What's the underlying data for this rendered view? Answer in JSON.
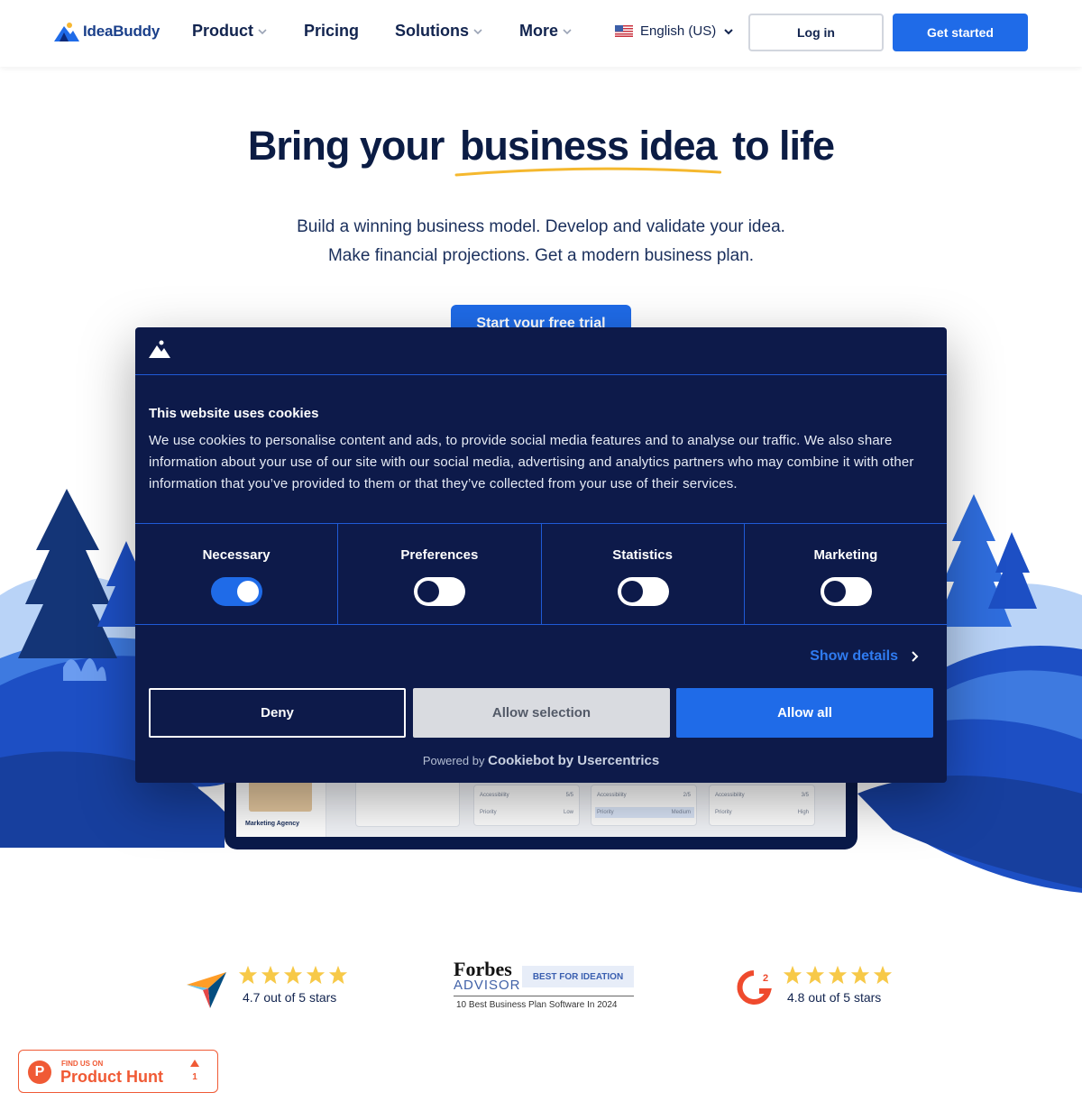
{
  "header": {
    "logo_text": "IdeaBuddy",
    "nav": [
      {
        "label": "Product"
      },
      {
        "label": "Pricing"
      },
      {
        "label": "Solutions"
      },
      {
        "label": "More"
      }
    ],
    "language": "English (US)",
    "login_label": "Log in",
    "get_started_label": "Get started"
  },
  "hero": {
    "title_before": "Bring your",
    "title_highlight": "business idea",
    "title_after": "to life",
    "subtitle_line1": "Build a winning business model. Develop and validate your idea.",
    "subtitle_line2": "Make financial projections. Get a modern business plan.",
    "cta_label": "Start your free trial"
  },
  "app_preview": {
    "agency_label": "Marketing Agency",
    "cards": [
      {
        "row1_label": "Accessibility",
        "row1_value": "5/5",
        "row2_label": "Priority",
        "row2_value": "Low"
      },
      {
        "row1_label": "Accessibility",
        "row1_value": "2/5",
        "row2_label": "Priority",
        "row2_value": "Medium"
      },
      {
        "row1_label": "Accessibility",
        "row1_value": "3/5",
        "row2_label": "Priority",
        "row2_value": "High"
      }
    ]
  },
  "cookie": {
    "title": "This website uses cookies",
    "text": "We use cookies to personalise content and ads, to provide social media features and to analyse our traffic. We also share information about your use of our site with our social media, advertising and analytics partners who may combine it with other information that you’ve provided to them or that they’ve collected from your use of their services.",
    "toggles": [
      {
        "label": "Necessary",
        "on": true
      },
      {
        "label": "Preferences",
        "on": false
      },
      {
        "label": "Statistics",
        "on": false
      },
      {
        "label": "Marketing",
        "on": false
      }
    ],
    "show_details": "Show details",
    "deny": "Deny",
    "allow_selection": "Allow selection",
    "allow_all": "Allow all",
    "powered_prefix": "Powered by",
    "powered_brand": "Cookiebot by Usercentrics"
  },
  "ratings": {
    "capterra_text": "4.7 out of 5 stars",
    "forbes_name": "Forbes",
    "forbes_advisor": "ADVISOR",
    "forbes_badge": "BEST FOR IDEATION",
    "forbes_caption": "10 Best Business Plan Software In 2024",
    "g2_text": "4.8 out of 5 stars"
  },
  "product_hunt": {
    "find_us": "FIND US ON",
    "name": "Product Hunt",
    "count": "1"
  },
  "colors": {
    "brand_blue": "#1f6be8",
    "navy": "#0d1a4a",
    "star": "#f7c948",
    "product_hunt": "#f05a35"
  }
}
